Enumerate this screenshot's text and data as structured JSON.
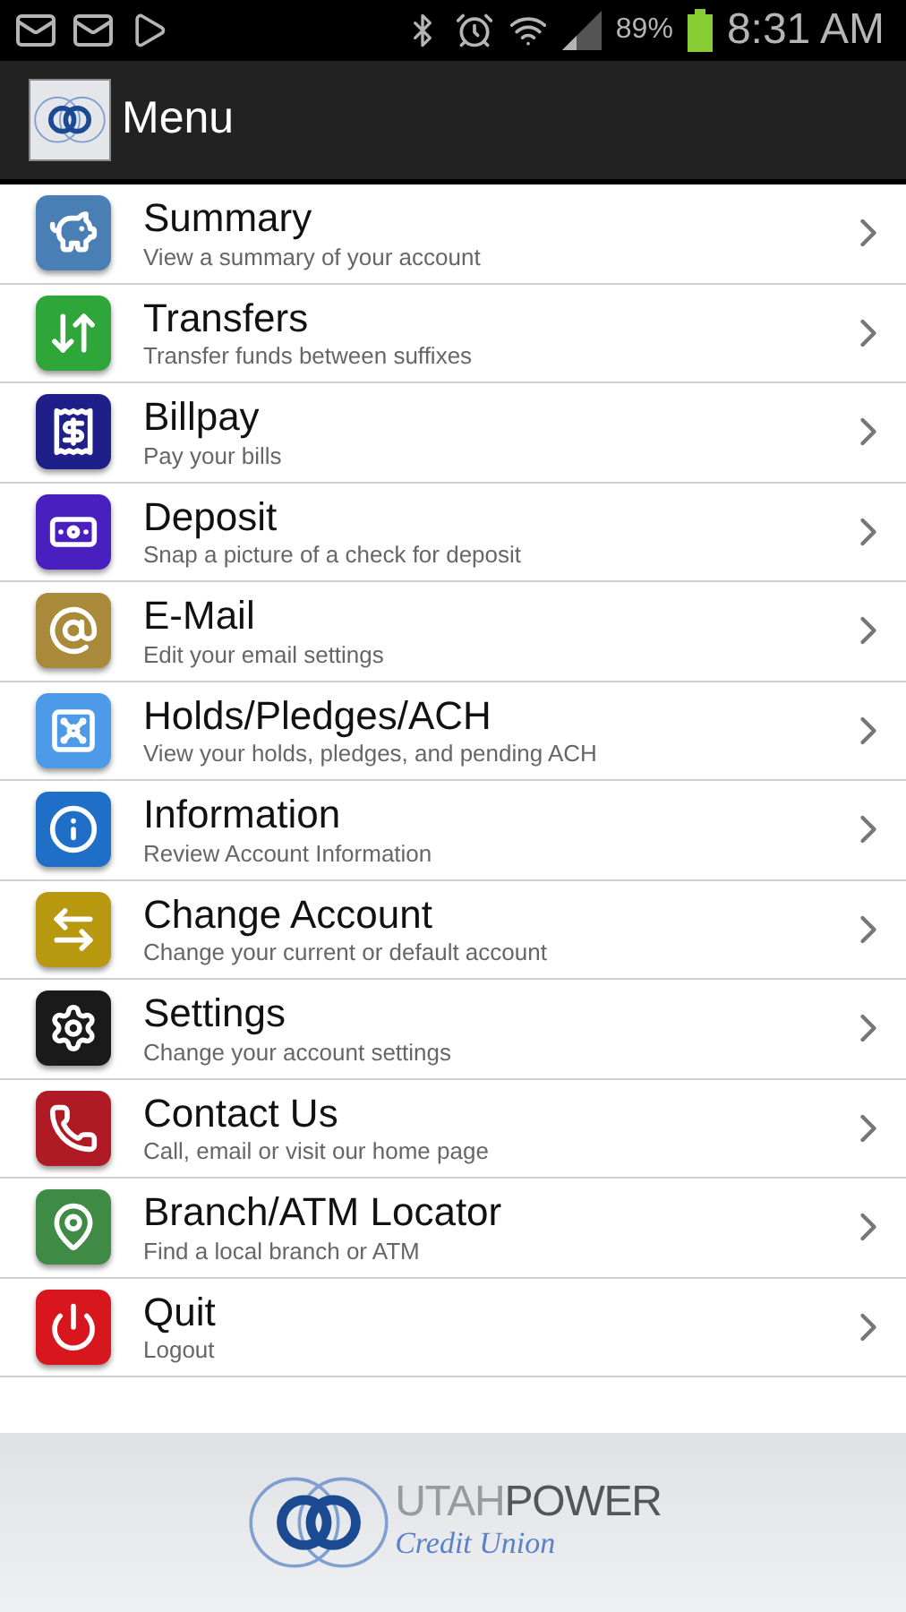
{
  "status_bar": {
    "battery": "89%",
    "time": "8:31 AM"
  },
  "action_bar": {
    "title": "Menu"
  },
  "menu": [
    {
      "kind": "piggy",
      "color": "#4a7fb5",
      "title": "Summary",
      "subtitle": "View a summary of your account"
    },
    {
      "kind": "transfer",
      "color": "#2fa63a",
      "title": "Transfers",
      "subtitle": "Transfer funds between suffixes"
    },
    {
      "kind": "bill",
      "color": "#1f1f8a",
      "title": "Billpay",
      "subtitle": "Pay your bills"
    },
    {
      "kind": "deposit",
      "color": "#4a1fc0",
      "title": "Deposit",
      "subtitle": "Snap a picture of a check for deposit"
    },
    {
      "kind": "email",
      "color": "#a88a3a",
      "title": "E-Mail",
      "subtitle": "Edit your email settings"
    },
    {
      "kind": "safe",
      "color": "#4d9ae8",
      "title": "Holds/Pledges/ACH",
      "subtitle": "View your holds, pledges, and pending ACH"
    },
    {
      "kind": "info",
      "color": "#1f6fc8",
      "title": "Information",
      "subtitle": "Review Account Information"
    },
    {
      "kind": "exchange",
      "color": "#b8980f",
      "title": "Change Account",
      "subtitle": "Change your current or default account"
    },
    {
      "kind": "gear",
      "color": "#1a1a1a",
      "title": "Settings",
      "subtitle": "Change your account settings"
    },
    {
      "kind": "phone",
      "color": "#b01a25",
      "title": "Contact Us",
      "subtitle": "Call, email or visit our home page"
    },
    {
      "kind": "pin",
      "color": "#3f8a45",
      "title": "Branch/ATM Locator",
      "subtitle": "Find a local branch or ATM"
    },
    {
      "kind": "power",
      "color": "#d8161e",
      "title": "Quit",
      "subtitle": "Logout"
    }
  ],
  "footer": {
    "logo_word_1": "UTAH",
    "logo_word_2": "POWER",
    "logo_tagline": "Credit Union"
  }
}
